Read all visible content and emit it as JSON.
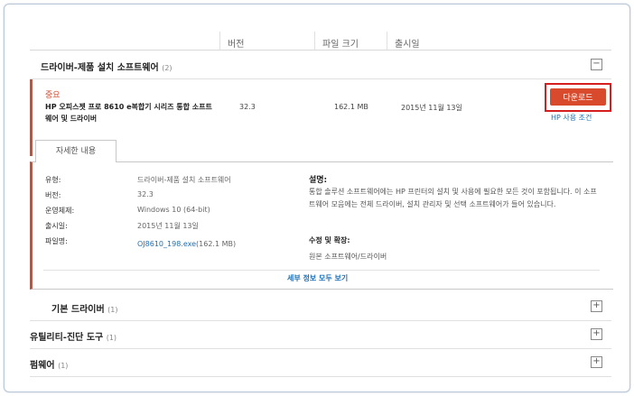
{
  "columns": {
    "version": "버전",
    "file_size": "파일 크기",
    "release_date": "출시일"
  },
  "sections": {
    "driver_install": {
      "title": "드라이버-제품 설치 소프트웨어",
      "count": "(2)",
      "toggle": "−"
    },
    "basic_driver": {
      "title": "기본 드라이버",
      "count": "(1)",
      "toggle": "+"
    },
    "utility": {
      "title": "유틸리티-진단 도구",
      "count": "(1)",
      "toggle": "+"
    },
    "firmware": {
      "title": "펌웨어",
      "count": "(1)",
      "toggle": "+"
    }
  },
  "item": {
    "importance": "중요",
    "name": "HP 오피스젯 프로 8610 e복합기 시리즈 통합 소프트웨어 및 드라이버",
    "version": "32.3",
    "size": "162.1 MB",
    "date": "2015년 11월 13일",
    "download_label": "다운로드",
    "terms_label": "HP 사용 조건"
  },
  "details": {
    "tab_label": "자세한 내용",
    "type_label": "유형:",
    "type_value": "드라이버-제품 설치 소프트웨어",
    "version_label": "버전:",
    "version_value": "32.3",
    "os_label": "운영체제:",
    "os_value": "Windows 10 (64-bit)",
    "date_label": "출시일:",
    "date_value": "2015년 11월 13일",
    "file_label": "파일명:",
    "file_link": "OJ8610_198.exe",
    "file_size": "(162.1 MB)",
    "desc_title": "설명:",
    "desc_body": "통합 솔루션 소프트웨어에는 HP 프린터의 설치 및 사용에 필요한 모든 것이 포함됩니다. 이 소프트웨어 모음에는 전체 드라이버, 설치 관리자 및 선택 소프트웨어가 들어 있습니다.",
    "fix_title": "수정 및 확장:",
    "fix_body": "원본 소프트웨어/드라이버",
    "more_label": "세부 정보 모두 보기"
  }
}
